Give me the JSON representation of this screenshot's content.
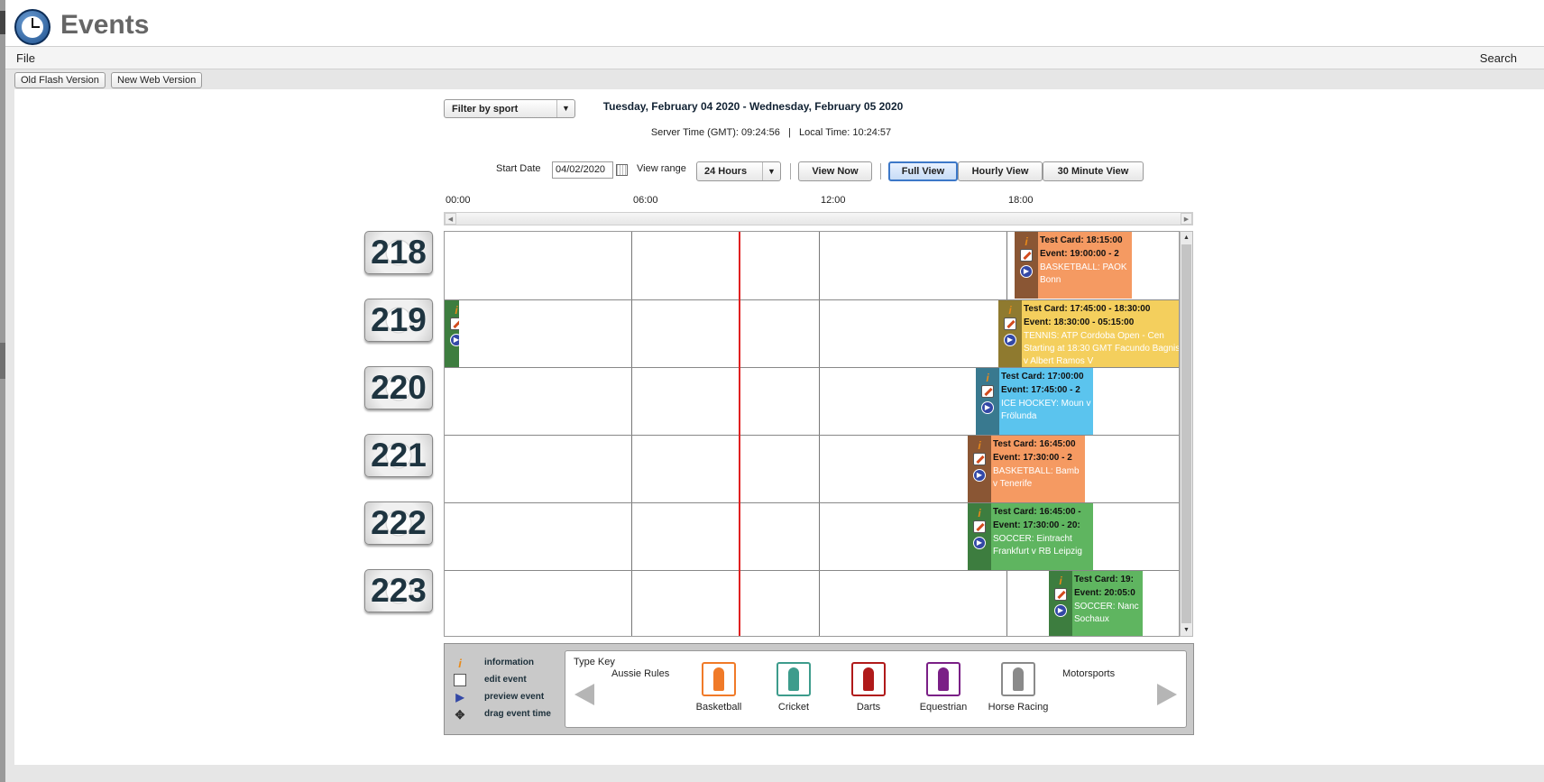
{
  "app": {
    "title": "Events"
  },
  "menu": {
    "file": "File",
    "search": "Search"
  },
  "version_buttons": [
    "Old Flash Version",
    "New Web Version"
  ],
  "filter": {
    "label": "Filter by sport"
  },
  "header": {
    "date_range": "Tuesday, February 04 2020 -  Wednesday, February 05 2020",
    "server_time": "Server Time (GMT): 09:24:56   |   Local Time: 10:24:57"
  },
  "controls": {
    "start_date_label": "Start Date",
    "start_date_value": "04/02/2020",
    "view_range_label": "View range",
    "view_range_value": "24 Hours",
    "view_now": "View Now",
    "full_view": "Full View",
    "hourly_view": "Hourly View",
    "thirty_min_view": "30 Minute View"
  },
  "timeline": {
    "labels": [
      "00:00",
      "06:00",
      "12:00",
      "18:00"
    ]
  },
  "channels": [
    "218",
    "219",
    "220",
    "221",
    "222",
    "223"
  ],
  "events": [
    {
      "l1": "Test Card: 18:15:00",
      "l2": "Event: 19:00:00 - 2",
      "l3": "BASKETBALL: PAOK Bonn",
      "color": "#f59a62",
      "icon_bg": "#8a5634"
    },
    {
      "l1": "",
      "l2": "",
      "l3": "",
      "color": "#5fb560",
      "icon_bg": "#3d7d3f"
    },
    {
      "l1": "Test Card: 17:45:00 - 18:30:00",
      "l2": "Event: 18:30:00 - 05:15:00",
      "l3": "TENNIS: ATP Cordoba Open - Cen Starting at 18:30 GMT Facundo Bagnis v Albert Ramos V",
      "color": "#f4cf5d",
      "icon_bg": "#8f7a2f"
    },
    {
      "l1": "Test Card: 17:00:00",
      "l2": "Event: 17:45:00 - 2",
      "l3": "ICE HOCKEY: Moun v Frölunda",
      "color": "#5bc4ee",
      "icon_bg": "#39798f"
    },
    {
      "l1": "Test Card: 16:45:00",
      "l2": "Event: 17:30:00 - 2",
      "l3": "BASKETBALL: Bamb v Tenerife",
      "color": "#f59a62",
      "icon_bg": "#8a5634"
    },
    {
      "l1": "Test Card: 16:45:00 -",
      "l2": "Event: 17:30:00 - 20:",
      "l3": "SOCCER: Eintracht Frankfurt v RB Leipzig",
      "color": "#5fb560",
      "icon_bg": "#3d7d3f"
    },
    {
      "l1": "Test Card: 19:",
      "l2": "Event: 20:05:0",
      "l3": "SOCCER: Nanc Sochaux",
      "color": "#5fb560",
      "icon_bg": "#3d7d3f"
    }
  ],
  "legend": {
    "information": "information",
    "edit_event": "edit event",
    "preview_event": "preview event",
    "drag_event_time": "drag event time"
  },
  "type_key": {
    "title": "Type Key",
    "items": [
      {
        "label": "Aussie Rules",
        "color": ""
      },
      {
        "label": "Basketball",
        "color": "#f07a28"
      },
      {
        "label": "Cricket",
        "color": "#3d9c8c"
      },
      {
        "label": "Darts",
        "color": "#b01a1a"
      },
      {
        "label": "Equestrian",
        "color": "#7a1f86"
      },
      {
        "label": "Horse Racing",
        "color": "#8a8a8a"
      },
      {
        "label": "Motorsports",
        "color": ""
      }
    ]
  }
}
